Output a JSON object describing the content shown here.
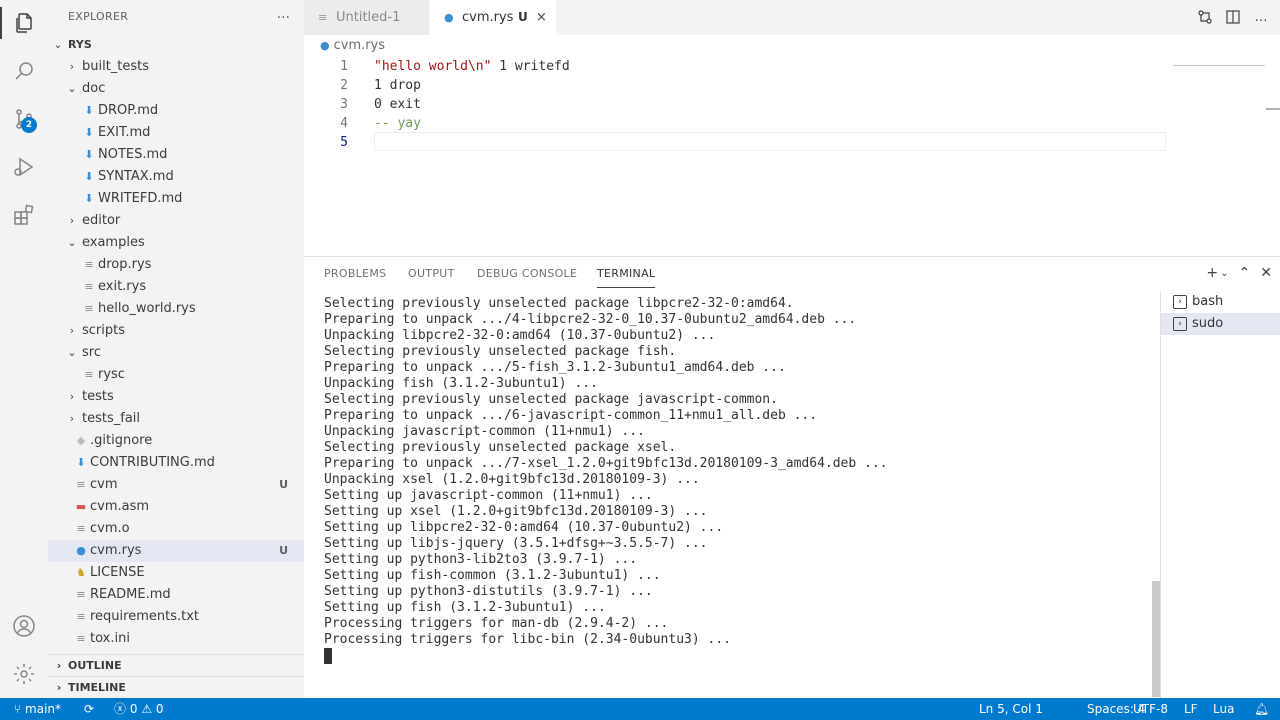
{
  "activity_bar": {
    "scm_badge": "2",
    "icons": [
      "explorer-icon",
      "search-icon",
      "source-control-icon",
      "run-debug-icon",
      "extensions-icon",
      "account-icon",
      "manage-gear-icon"
    ]
  },
  "sidebar": {
    "title": "EXPLORER",
    "more": "...",
    "root": "RYS",
    "items": [
      {
        "label": "built_tests",
        "type": "folder",
        "expanded": false,
        "git": ""
      },
      {
        "label": "doc",
        "type": "folder",
        "expanded": true,
        "git": ""
      },
      {
        "label": "DROP.md",
        "type": "md",
        "git": ""
      },
      {
        "label": "EXIT.md",
        "type": "md",
        "git": ""
      },
      {
        "label": "NOTES.md",
        "type": "md",
        "git": ""
      },
      {
        "label": "SYNTAX.md",
        "type": "md",
        "git": ""
      },
      {
        "label": "WRITEFD.md",
        "type": "md",
        "git": ""
      },
      {
        "label": "editor",
        "type": "folder",
        "expanded": false,
        "git": ""
      },
      {
        "label": "examples",
        "type": "folder",
        "expanded": true,
        "git": ""
      },
      {
        "label": "drop.rys",
        "type": "file",
        "git": ""
      },
      {
        "label": "exit.rys",
        "type": "file",
        "git": ""
      },
      {
        "label": "hello_world.rys",
        "type": "file",
        "git": ""
      },
      {
        "label": "scripts",
        "type": "folder",
        "expanded": false,
        "git": ""
      },
      {
        "label": "src",
        "type": "folder",
        "expanded": true,
        "git": ""
      },
      {
        "label": "rysc",
        "type": "file",
        "git": ""
      },
      {
        "label": "tests",
        "type": "folder",
        "expanded": false,
        "git": ""
      },
      {
        "label": "tests_fail",
        "type": "folder",
        "expanded": false,
        "git": ""
      },
      {
        "label": ".gitignore",
        "type": "git",
        "git": ""
      },
      {
        "label": "CONTRIBUTING.md",
        "type": "md",
        "git": ""
      },
      {
        "label": "cvm",
        "type": "file",
        "git": "U"
      },
      {
        "label": "cvm.asm",
        "type": "asm",
        "git": ""
      },
      {
        "label": "cvm.o",
        "type": "file",
        "git": ""
      },
      {
        "label": "cvm.rys",
        "type": "rys",
        "git": "U"
      },
      {
        "label": "LICENSE",
        "type": "license",
        "git": ""
      },
      {
        "label": "README.md",
        "type": "file",
        "git": ""
      },
      {
        "label": "requirements.txt",
        "type": "file",
        "git": ""
      },
      {
        "label": "tox.ini",
        "type": "file",
        "git": ""
      }
    ],
    "outline": "OUTLINE",
    "timeline": "TIMELINE"
  },
  "tabs": [
    {
      "label": "Untitled-1",
      "active": false
    },
    {
      "label": "cvm.rys",
      "active": true,
      "git": "U",
      "close": "×"
    }
  ],
  "breadcrumb": "cvm.rys",
  "editor": {
    "lines": [
      {
        "num": "1",
        "parts": [
          {
            "t": "\"hello world\\n\"",
            "c": "str"
          },
          {
            "t": " 1 writefd",
            "c": ""
          }
        ]
      },
      {
        "num": "2",
        "parts": [
          {
            "t": "1 drop",
            "c": ""
          }
        ]
      },
      {
        "num": "3",
        "parts": [
          {
            "t": "0 exit",
            "c": ""
          }
        ]
      },
      {
        "num": "4",
        "parts": [
          {
            "t": "-- yay",
            "c": "com"
          }
        ]
      },
      {
        "num": "5",
        "parts": []
      }
    ]
  },
  "panel": {
    "tabs": [
      "PROBLEMS",
      "OUTPUT",
      "DEBUG CONSOLE",
      "TERMINAL"
    ],
    "active_tab": "TERMINAL",
    "terminal_lines": [
      "Selecting previously unselected package libpcre2-32-0:amd64.",
      "Preparing to unpack .../4-libpcre2-32-0_10.37-0ubuntu2_amd64.deb ...",
      "Unpacking libpcre2-32-0:amd64 (10.37-0ubuntu2) ...",
      "Selecting previously unselected package fish.",
      "Preparing to unpack .../5-fish_3.1.2-3ubuntu1_amd64.deb ...",
      "Unpacking fish (3.1.2-3ubuntu1) ...",
      "Selecting previously unselected package javascript-common.",
      "Preparing to unpack .../6-javascript-common_11+nmu1_all.deb ...",
      "Unpacking javascript-common (11+nmu1) ...",
      "Selecting previously unselected package xsel.",
      "Preparing to unpack .../7-xsel_1.2.0+git9bfc13d.20180109-3_amd64.deb ...",
      "Unpacking xsel (1.2.0+git9bfc13d.20180109-3) ...",
      "Setting up javascript-common (11+nmu1) ...",
      "Setting up xsel (1.2.0+git9bfc13d.20180109-3) ...",
      "Setting up libpcre2-32-0:amd64 (10.37-0ubuntu2) ...",
      "Setting up libjs-jquery (3.5.1+dfsg+~3.5.5-7) ...",
      "Setting up python3-lib2to3 (3.9.7-1) ...",
      "Setting up fish-common (3.1.2-3ubuntu1) ...",
      "Setting up python3-distutils (3.9.7-1) ...",
      "Setting up fish (3.1.2-3ubuntu1) ...",
      "Processing triggers for man-db (2.9.4-2) ...",
      "Processing triggers for libc-bin (2.34-0ubuntu3) ..."
    ],
    "terminals": [
      "bash",
      "sudo"
    ],
    "selected_terminal": "sudo"
  },
  "status_bar": {
    "branch": "main*",
    "errors": "0",
    "warnings": "0",
    "position": "Ln 5, Col 1",
    "spaces": "Spaces: 4",
    "encoding": "UTF-8",
    "eol": "LF",
    "language": "Lua"
  },
  "colors": {
    "accent": "#007acc",
    "activity_bg": "#f3f3f3",
    "selection": "#e4e6f1"
  }
}
